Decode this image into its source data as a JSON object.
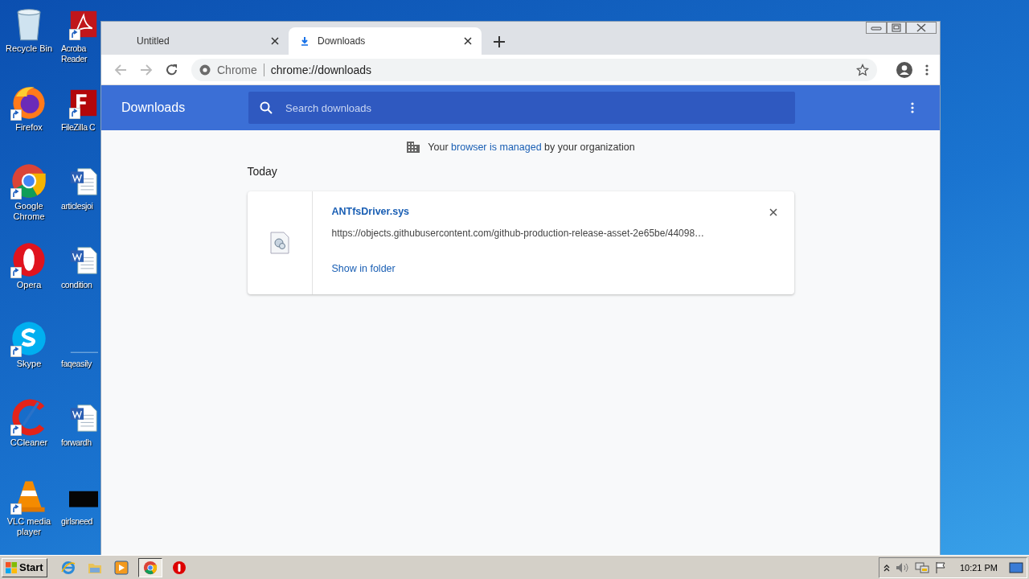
{
  "desktop": {
    "columns": [
      {
        "icons": [
          {
            "kind": "recycle",
            "label": "Recycle Bin",
            "shortcut": false
          },
          {
            "kind": "firefox",
            "label": "Firefox",
            "shortcut": true
          },
          {
            "kind": "chrome",
            "label": "Google Chrome",
            "shortcut": true
          },
          {
            "kind": "opera",
            "label": "Opera",
            "shortcut": true
          },
          {
            "kind": "skype",
            "label": "Skype",
            "shortcut": true
          },
          {
            "kind": "ccleaner",
            "label": "CCleaner",
            "shortcut": true
          },
          {
            "kind": "vlc",
            "label": "VLC media player",
            "shortcut": true
          }
        ]
      },
      {
        "icons": [
          {
            "kind": "pdf",
            "label": "Acroba Reader",
            "shortcut": true
          },
          {
            "kind": "filezilla",
            "label": "FileZilla C",
            "shortcut": true
          },
          {
            "kind": "word",
            "label": "articlesjoi",
            "shortcut": false
          },
          {
            "kind": "word",
            "label": "condition",
            "shortcut": false
          },
          {
            "kind": "blank",
            "label": "faqeasily",
            "shortcut": false
          },
          {
            "kind": "word",
            "label": "forwardh",
            "shortcut": false
          },
          {
            "kind": "dark",
            "label": "girlsneed",
            "shortcut": false
          }
        ]
      }
    ]
  },
  "browser": {
    "tabs": [
      {
        "title": "Untitled",
        "selected": false,
        "kind": "page"
      },
      {
        "title": "Downloads",
        "selected": true,
        "kind": "download"
      }
    ],
    "omnibox": {
      "chip": "Chrome",
      "url": "chrome://downloads"
    },
    "header": {
      "title": "Downloads",
      "search_placeholder": "Search downloads"
    },
    "managed_notice": {
      "before": "Your",
      "link": "browser is managed",
      "after": "by your organization"
    },
    "date_heading": "Today",
    "downloads": [
      {
        "filename": "ANTfsDriver.sys",
        "url": "https://objects.githubusercontent.com/github-production-release-asset-2e65be/44098…",
        "action": "Show in folder"
      }
    ]
  },
  "taskbar": {
    "start": "Start",
    "apps": [
      {
        "kind": "ie",
        "selected": false
      },
      {
        "kind": "explorer",
        "selected": false
      },
      {
        "kind": "media",
        "selected": false
      },
      {
        "kind": "chrome",
        "selected": true
      },
      {
        "kind": "opera",
        "selected": false
      }
    ],
    "clock": "10:21 PM"
  }
}
